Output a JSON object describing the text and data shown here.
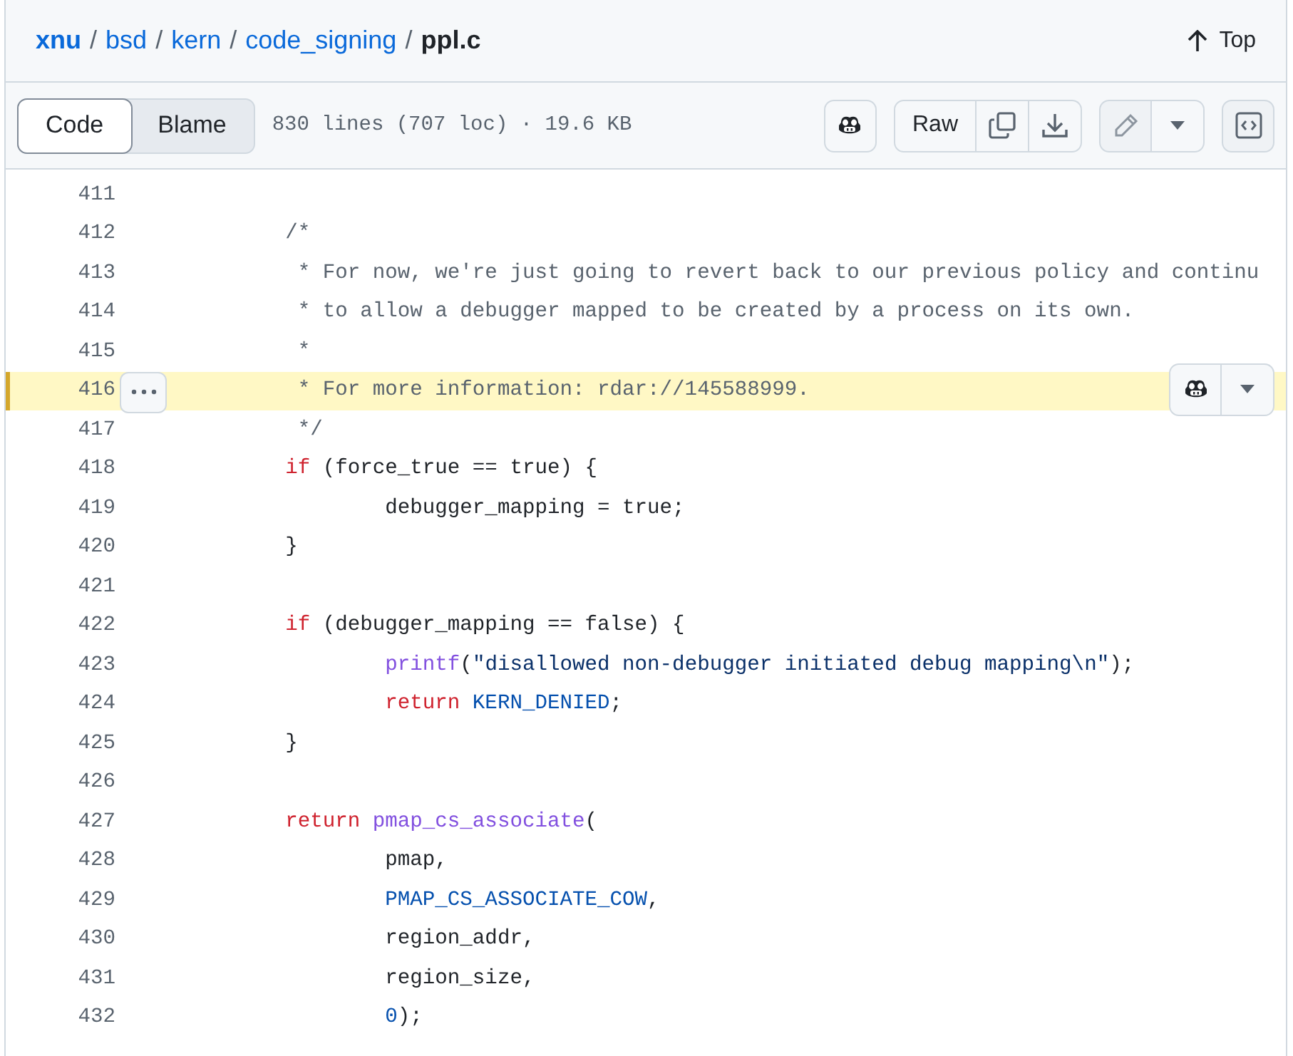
{
  "breadcrumb": [
    {
      "label": "xnu",
      "kind": "repo"
    },
    {
      "separator": "/",
      "label": "bsd",
      "kind": "dir"
    },
    {
      "separator": "/",
      "label": "kern",
      "kind": "dir"
    },
    {
      "separator": "/",
      "label": "code_signing",
      "kind": "dir"
    },
    {
      "separator": "/",
      "label": "ppl.c",
      "kind": "file"
    }
  ],
  "top_link": "Top",
  "tabs": [
    {
      "label": "Code",
      "selected": true
    },
    {
      "label": "Blame",
      "selected": false
    }
  ],
  "file_info": "830 lines (707 loc) · 19.6 KB",
  "raw_button": "Raw",
  "code_lines": [
    {
      "number": "411",
      "highlighted": false
    },
    {
      "number": "412",
      "highlighted": false,
      "tokens": [
        {
          "text": "\t/*",
          "kind": "comment"
        }
      ]
    },
    {
      "number": "413",
      "highlighted": false,
      "tokens": [
        {
          "text": "\t * For now, we're just going to revert back to our previous policy and continu",
          "kind": "comment"
        }
      ]
    },
    {
      "number": "414",
      "highlighted": false,
      "tokens": [
        {
          "text": "\t * to allow a debugger mapped to be created by a process on its own.",
          "kind": "comment"
        }
      ]
    },
    {
      "number": "415",
      "highlighted": false,
      "tokens": [
        {
          "text": "\t *",
          "kind": "comment"
        }
      ]
    },
    {
      "number": "416",
      "highlighted": true,
      "tokens": [
        {
          "text": "\t * For more information: rdar://145588999.",
          "kind": "comment"
        }
      ]
    },
    {
      "number": "417",
      "highlighted": false,
      "tokens": [
        {
          "text": "\t */",
          "kind": "comment"
        }
      ]
    },
    {
      "number": "418",
      "highlighted": false,
      "tokens": [
        {
          "text": "\tif",
          "kind": "keyword"
        },
        {
          "text": " (force_true == true) {",
          "kind": "plain"
        }
      ]
    },
    {
      "number": "419",
      "highlighted": false,
      "tokens": [
        {
          "text": "\t\tdebugger_mapping = true;",
          "kind": "plain"
        }
      ]
    },
    {
      "number": "420",
      "highlighted": false,
      "tokens": [
        {
          "text": "\t}",
          "kind": "plain"
        }
      ]
    },
    {
      "number": "421",
      "highlighted": false
    },
    {
      "number": "422",
      "highlighted": false,
      "tokens": [
        {
          "text": "\tif",
          "kind": "keyword"
        },
        {
          "text": " (debugger_mapping == false) {",
          "kind": "plain"
        }
      ]
    },
    {
      "number": "423",
      "highlighted": false,
      "tokens": [
        {
          "text": "\t\tprintf",
          "kind": "function"
        },
        {
          "text": "(",
          "kind": "plain"
        },
        {
          "text": "\"disallowed non-debugger initiated debug mapping\\n\"",
          "kind": "string"
        },
        {
          "text": ");",
          "kind": "plain"
        }
      ]
    },
    {
      "number": "424",
      "highlighted": false,
      "tokens": [
        {
          "text": "\t\treturn",
          "kind": "keyword"
        },
        {
          "text": " KERN_DENIED",
          "kind": "constant"
        },
        {
          "text": ";",
          "kind": "plain"
        }
      ]
    },
    {
      "number": "425",
      "highlighted": false,
      "tokens": [
        {
          "text": "\t}",
          "kind": "plain"
        }
      ]
    },
    {
      "number": "426",
      "highlighted": false
    },
    {
      "number": "427",
      "highlighted": false,
      "tokens": [
        {
          "text": "\treturn",
          "kind": "keyword"
        },
        {
          "text": " pmap_cs_associate",
          "kind": "function"
        },
        {
          "text": "(",
          "kind": "plain"
        }
      ]
    },
    {
      "number": "428",
      "highlighted": false,
      "tokens": [
        {
          "text": "\t\tpmap,",
          "kind": "plain"
        }
      ]
    },
    {
      "number": "429",
      "highlighted": false,
      "tokens": [
        {
          "text": "\t\tPMAP_CS_ASSOCIATE_COW",
          "kind": "constant"
        },
        {
          "text": ",",
          "kind": "plain"
        }
      ]
    },
    {
      "number": "430",
      "highlighted": false,
      "tokens": [
        {
          "text": "\t\tregion_addr,",
          "kind": "plain"
        }
      ]
    },
    {
      "number": "431",
      "highlighted": false,
      "tokens": [
        {
          "text": "\t\tregion_size,",
          "kind": "plain"
        }
      ]
    },
    {
      "number": "432",
      "highlighted": false,
      "tokens": [
        {
          "text": "\t\t0",
          "kind": "constant"
        },
        {
          "text": ");",
          "kind": "plain"
        }
      ]
    }
  ]
}
